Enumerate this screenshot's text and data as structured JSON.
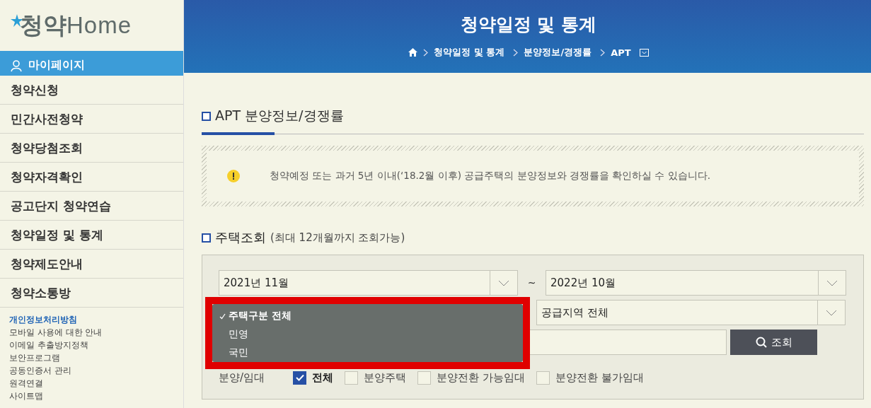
{
  "sidebar": {
    "logo": {
      "hangul": "청약",
      "latin": "Home"
    },
    "mypage": "마이페이지",
    "menu": [
      {
        "label": "청약신청"
      },
      {
        "label": "민간사전청약"
      },
      {
        "label": "청약당첨조회"
      },
      {
        "label": "청약자격확인"
      },
      {
        "label": "공고단지 청약연습"
      },
      {
        "label": "청약일정 및 통계"
      },
      {
        "label": "청약제도안내"
      },
      {
        "label": "청약소통방"
      }
    ],
    "footer_links": [
      {
        "label": "개인정보처리방침",
        "highlight": true
      },
      {
        "label": "모바일 사용에 대한 안내",
        "highlight": false
      },
      {
        "label": "이메일 추출방지정책",
        "highlight": false
      },
      {
        "label": "보안프로그램",
        "highlight": false
      },
      {
        "label": "공동인증서 관리",
        "highlight": false
      },
      {
        "label": "원격연결",
        "highlight": false
      },
      {
        "label": "사이트맵",
        "highlight": false
      }
    ]
  },
  "header": {
    "title": "청약일정 및 통계",
    "breadcrumb": [
      "청약일정 및 통계",
      "분양정보/경쟁률",
      "APT"
    ]
  },
  "section_title": "APT 분양정보/경쟁률",
  "notice": "청약예정 또는 과거 5년 이내(‘18.2월 이후) 공급주택의 분양정보와 경쟁률을 확인하실 수 있습니다.",
  "search": {
    "title": "주택조회",
    "note": "(최대 12개월까지 조회가능)",
    "from": "2021년 11월",
    "separator": "~",
    "to": "2022년 10월",
    "region": "공급지역 전체",
    "button": "조회",
    "dropdown": [
      {
        "label": "주택구분 전체",
        "selected": true
      },
      {
        "label": "민영",
        "selected": false
      },
      {
        "label": "국민",
        "selected": false
      }
    ],
    "type_label": "분양/임대",
    "types": [
      {
        "label": "전체",
        "checked": true
      },
      {
        "label": "분양주택",
        "checked": false
      },
      {
        "label": "분양전환 가능임대",
        "checked": false
      },
      {
        "label": "분양전환 불가임대",
        "checked": false
      }
    ]
  }
}
